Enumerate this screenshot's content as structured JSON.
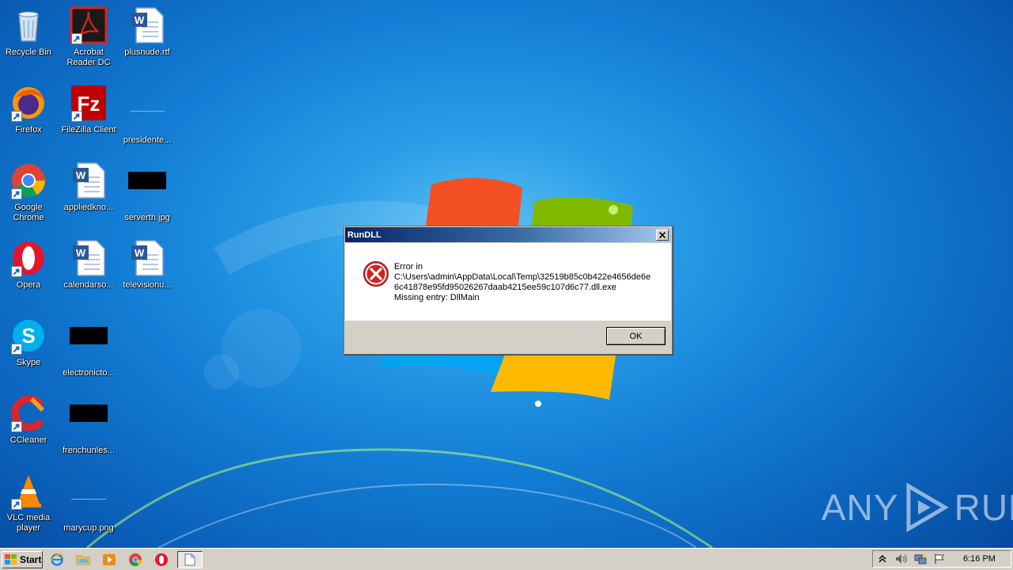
{
  "desktop": {
    "icons": [
      {
        "label": "Recycle Bin"
      },
      {
        "label": "Acrobat Reader DC"
      },
      {
        "label": "plusnude.rtf"
      },
      {
        "label": "Firefox"
      },
      {
        "label": "FileZilla Client"
      },
      {
        "label": "presidente..."
      },
      {
        "label": "Google Chrome"
      },
      {
        "label": "appliedkno..."
      },
      {
        "label": "serverth.jpg"
      },
      {
        "label": "Opera"
      },
      {
        "label": "calendarso..."
      },
      {
        "label": "televisionu..."
      },
      {
        "label": "Skype"
      },
      {
        "label": "electronicto..."
      },
      {
        "label": "CCleaner"
      },
      {
        "label": "frenchunles..."
      },
      {
        "label": "VLC media player"
      },
      {
        "label": "marycup.png"
      }
    ]
  },
  "dialog": {
    "title": "RunDLL",
    "line1": "Error in",
    "line2": "C:\\Users\\admin\\AppData\\Local\\Temp\\32519b85c0b422e4656de6e",
    "line3": "6c41878e95fd95026267daab4215ee59c107d6c77.dll.exe",
    "line4": "Missing entry: DllMain",
    "ok_label": "OK"
  },
  "taskbar": {
    "start_label": "Start",
    "clock": "6:16 PM"
  },
  "watermark": {
    "left": "ANY",
    "right": "RUN"
  }
}
